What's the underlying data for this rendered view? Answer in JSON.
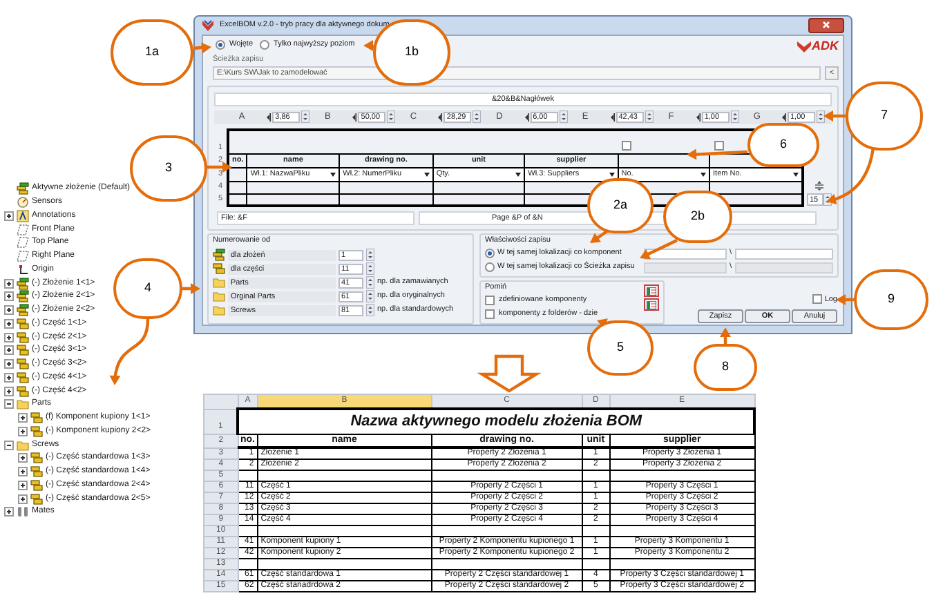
{
  "tree": {
    "root": {
      "kind": "assembly",
      "label": "Aktywne złożenie  (Default)"
    },
    "items": [
      {
        "kind": "sensors",
        "label": "Sensors"
      },
      {
        "kind": "annotations",
        "label": "Annotations",
        "expanded": false
      },
      {
        "kind": "plane",
        "label": "Front Plane"
      },
      {
        "kind": "plane",
        "label": "Top Plane"
      },
      {
        "kind": "plane",
        "label": "Right Plane"
      },
      {
        "kind": "origin",
        "label": "Origin"
      },
      {
        "kind": "assembly",
        "label": "(-) Złożenie 1<1>",
        "expanded": false
      },
      {
        "kind": "assembly",
        "label": "(-) Złożenie 2<1>",
        "expanded": false
      },
      {
        "kind": "assembly",
        "label": "(-) Złożenie 2<2>",
        "expanded": false
      },
      {
        "kind": "part",
        "label": "(-) Część 1<1>",
        "expanded": false
      },
      {
        "kind": "part",
        "label": "(-) Część 2<1>",
        "expanded": false
      },
      {
        "kind": "part",
        "label": "(-) Część 3<1>",
        "expanded": false
      },
      {
        "kind": "part",
        "label": "(-) Część 3<2>",
        "expanded": false
      },
      {
        "kind": "part",
        "label": "(-) Część 4<1>",
        "expanded": false
      },
      {
        "kind": "part",
        "label": "(-) Część 4<2>",
        "expanded": false
      },
      {
        "kind": "folder",
        "label": "Parts",
        "expanded": true,
        "children": [
          {
            "kind": "part",
            "label": "(f) Komponent kupiony 1<1>",
            "expanded": false
          },
          {
            "kind": "part",
            "label": "(-) Komponent kupiony 2<2>",
            "expanded": false
          }
        ]
      },
      {
        "kind": "folder",
        "label": "Screws",
        "expanded": true,
        "children": [
          {
            "kind": "part",
            "label": "(-) Część standardowa 1<3>",
            "expanded": false
          },
          {
            "kind": "part",
            "label": "(-) Część standardowa 1<4>",
            "expanded": false
          },
          {
            "kind": "part",
            "label": "(-) Część standardowa 2<4>",
            "expanded": false
          },
          {
            "kind": "part",
            "label": "(-) Część standardowa 2<5>",
            "expanded": false
          }
        ]
      },
      {
        "kind": "mates",
        "label": "Mates",
        "expanded": false
      }
    ]
  },
  "dialog": {
    "title": "ExcelBOM v.2.0 - tryb pracy dla aktywnego dokum",
    "logo": "ADK",
    "scope_options": [
      {
        "label": "Wojęte",
        "selected": true
      },
      {
        "label": "Tylko najwyższy poziom",
        "selected": false
      }
    ],
    "save_path": {
      "label": "Ścieżka zapisu",
      "value": "E:\\Kurs SW\\Jak to zamodelować",
      "button": "<"
    },
    "header_field": "&20&B&Nagłówek",
    "column_widths": [
      {
        "letter": "A",
        "value": "3,86"
      },
      {
        "letter": "B",
        "value": "50,00"
      },
      {
        "letter": "C",
        "value": "28,29"
      },
      {
        "letter": "D",
        "value": "6,00"
      },
      {
        "letter": "E",
        "value": "42,43"
      },
      {
        "letter": "F",
        "value": "1,00"
      },
      {
        "letter": "G",
        "value": "1,00"
      }
    ],
    "grid": {
      "row_numbers": [
        "1",
        "2",
        "3",
        "4",
        "5"
      ],
      "columns": [
        {
          "header": "no."
        },
        {
          "header": "name",
          "property": "Wł.1: NazwaPliku"
        },
        {
          "header": "drawing no.",
          "property": "Wł.2: NumerPliku"
        },
        {
          "header": "unit",
          "property": "Qty."
        },
        {
          "header": "supplier",
          "property": "Wł.3: Suppliers"
        },
        {
          "property": "No.",
          "checked": false
        },
        {
          "property": "Item No.",
          "checked": false
        }
      ],
      "row_count": "15"
    },
    "footer_left": "File: &F",
    "footer_right": "Page &P of &N",
    "numbering": {
      "title": "Numerowanie od",
      "rows": [
        {
          "kind": "assembly",
          "label": "dla złożeń",
          "value": "1"
        },
        {
          "kind": "part",
          "label": "dla części",
          "value": "11"
        },
        {
          "kind": "folder",
          "label": "Parts",
          "value": "41",
          "note": "np. dla zamawianych"
        },
        {
          "kind": "folder",
          "label": "Orginal Parts",
          "value": "61",
          "note": "np. dla oryginalnych"
        },
        {
          "kind": "folder",
          "label": "Screws",
          "value": "81",
          "note": "np. dla standardowych"
        }
      ]
    },
    "save_properties": {
      "title": "Właściwości zapisu",
      "options": [
        {
          "label": "W tej samej lokalizacji co komponent",
          "selected": true,
          "disabled": false,
          "separator": "\\"
        },
        {
          "label": "W tej samej lokalizacji co Ścieżka zapisu",
          "selected": false,
          "disabled": true,
          "separator": "\\"
        }
      ]
    },
    "skip": {
      "title": "Pomiń",
      "options": [
        {
          "label": "zdefiniowane komponenty",
          "checked": false
        },
        {
          "label": "komponenty z folderów - dzie",
          "checked": false
        }
      ]
    },
    "log": {
      "label": "Log",
      "checked": false
    },
    "buttons": [
      "Zapisz",
      "OK",
      "Anuluj"
    ]
  },
  "sheet": {
    "columns": [
      {
        "letter": "A",
        "selected": false
      },
      {
        "letter": "B",
        "selected": true
      },
      {
        "letter": "C",
        "selected": false
      },
      {
        "letter": "D",
        "selected": false
      },
      {
        "letter": "E",
        "selected": false
      }
    ],
    "title": {
      "row": "1",
      "text": "Nazwa aktywnego modelu złożenia BOM"
    },
    "header": {
      "row": "2",
      "cells": [
        "no.",
        "name",
        "drawing no.",
        "unit",
        "supplier"
      ]
    },
    "rows": [
      {
        "number": "3",
        "cells": [
          "1",
          "Złożenie 1",
          "Property 2 Złożenia 1",
          "1",
          "Property 3 Złożenia 1"
        ]
      },
      {
        "number": "4",
        "cells": [
          "2",
          "Złożenie 2",
          "Property 2 Złożenia 2",
          "2",
          "Property 3 Złożenia 2"
        ]
      },
      {
        "number": "5"
      },
      {
        "number": "6",
        "cells": [
          "11",
          "Część 1",
          "Property 2 Części 1",
          "1",
          "Property 3 Części 1"
        ]
      },
      {
        "number": "7",
        "cells": [
          "12",
          "Część 2",
          "Property 2 Części 2",
          "1",
          "Property 3 Części 2"
        ]
      },
      {
        "number": "8",
        "cells": [
          "13",
          "Część 3",
          "Property 2 Części 3",
          "2",
          "Property 3 Części 3"
        ]
      },
      {
        "number": "9",
        "cells": [
          "14",
          "Część 4",
          "Property 2 Części 4",
          "2",
          "Property 3 Części 4"
        ]
      },
      {
        "number": "10"
      },
      {
        "number": "11",
        "cells": [
          "41",
          "Komponent kupiony 1",
          "Property 2 Komponentu kupionego 1",
          "1",
          "Property 3 Komponentu 1"
        ]
      },
      {
        "number": "12",
        "cells": [
          "42",
          "Komponent kupiony 2",
          "Property 2 Komponentu kupionego 2",
          "1",
          "Property 3 Komponentu 2"
        ]
      },
      {
        "number": "13"
      },
      {
        "number": "14",
        "cells": [
          "61",
          "Część standardowa 1",
          "Property 2 Części standardowej 1",
          "4",
          "Property 3 Części standardowej 1"
        ]
      },
      {
        "number": "15",
        "cells": [
          "62",
          "Część stanadrdowa 2",
          "Property 2 Części standardowej 2",
          "5",
          "Property 3 Części standardowej 2"
        ]
      }
    ]
  },
  "callouts": [
    {
      "label": "1a"
    },
    {
      "label": "1b"
    },
    {
      "label": "7"
    },
    {
      "label": "6"
    },
    {
      "label": "3"
    },
    {
      "label": "2a"
    },
    {
      "label": "2b"
    },
    {
      "label": "4"
    },
    {
      "label": "9"
    },
    {
      "label": "5"
    },
    {
      "label": "8"
    }
  ]
}
